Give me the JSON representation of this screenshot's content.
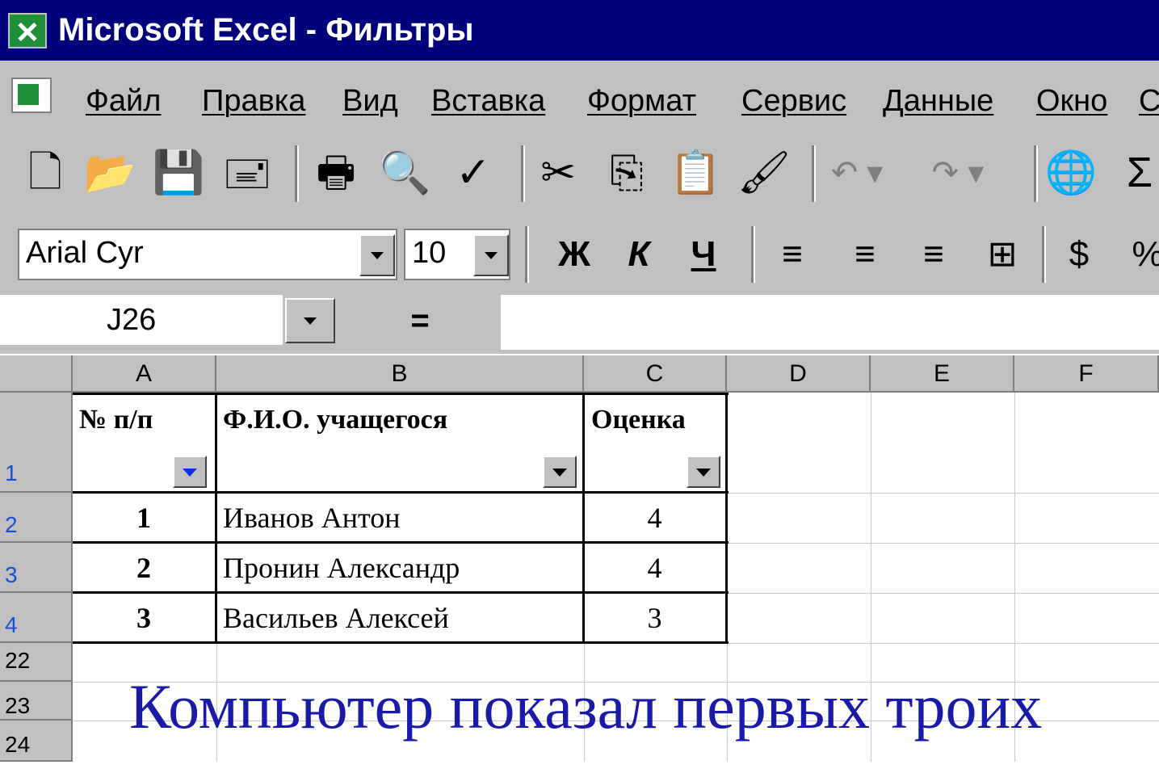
{
  "window": {
    "title": "Microsoft Excel - Фильтры"
  },
  "menu": {
    "items": [
      "Файл",
      "Правка",
      "Вид",
      "Вставка",
      "Формат",
      "Сервис",
      "Данные",
      "Окно",
      "С"
    ]
  },
  "toolbar": {
    "standard": [
      "new-icon",
      "open-icon",
      "save-icon",
      "email-icon",
      "print-icon",
      "print-preview-icon",
      "spelling-icon",
      "cut-icon",
      "copy-icon",
      "paste-icon",
      "format-painter-icon",
      "undo-icon",
      "redo-icon",
      "web-icon",
      "autosum-icon"
    ],
    "font_name": "Arial Cyr",
    "font_size": "10",
    "bold": "Ж",
    "italic": "К",
    "underline": "Ч",
    "percent": "%"
  },
  "formula_bar": {
    "name_box": "J26",
    "equals": "="
  },
  "columns": [
    "A",
    "B",
    "C",
    "D",
    "E",
    "F"
  ],
  "rows": [
    "1",
    "2",
    "3",
    "4",
    "22",
    "23",
    "24"
  ],
  "table": {
    "headers": [
      "№ п/п",
      "Ф.И.О. учащегося",
      "Оценка"
    ],
    "records": [
      {
        "num": "1",
        "name": "Иванов Антон",
        "grade": "4"
      },
      {
        "num": "2",
        "name": "Пронин Александр",
        "grade": "4"
      },
      {
        "num": "3",
        "name": "Васильев Алексей",
        "grade": "3"
      }
    ]
  },
  "caption": "Компьютер показал первых троих",
  "colors": {
    "titlebar": "#00007b",
    "chrome": "#c0c0c0",
    "caption": "#1a1aa8",
    "row_number": "#1a4fd0"
  }
}
